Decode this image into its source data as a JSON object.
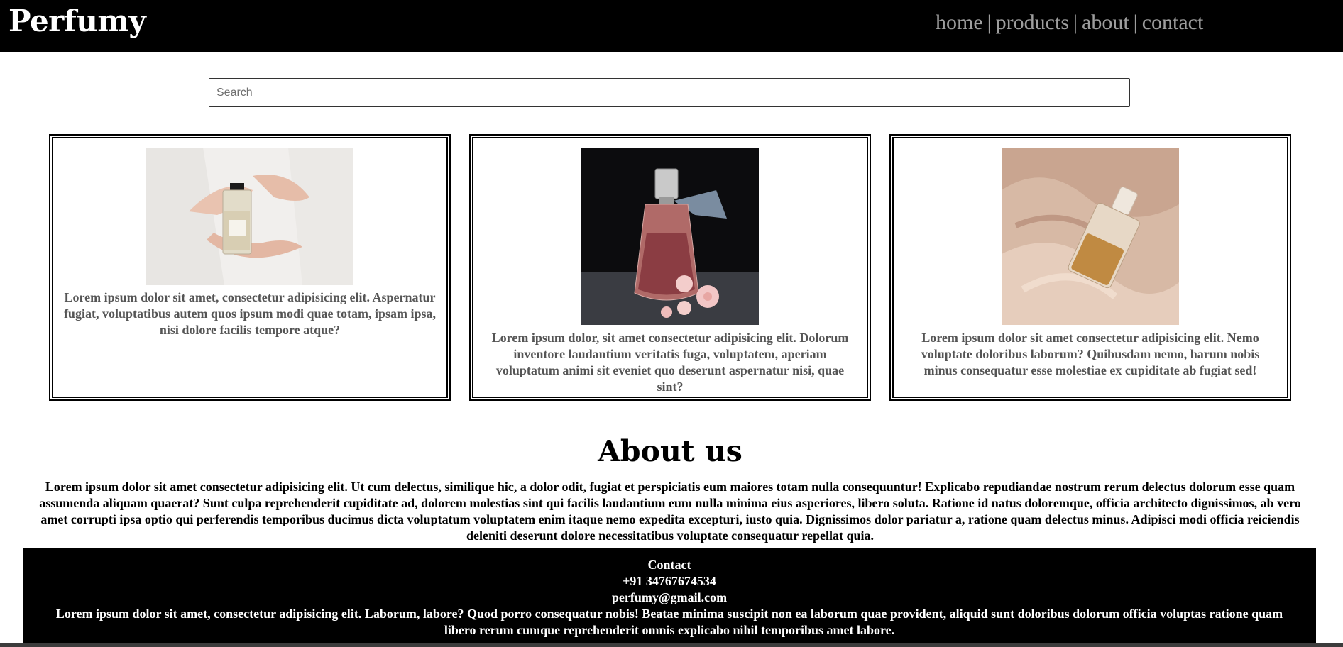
{
  "header": {
    "brand": "Perfumy",
    "nav": [
      {
        "label": "home"
      },
      {
        "label": "products"
      },
      {
        "label": "about"
      },
      {
        "label": "contact"
      }
    ],
    "separator": "|"
  },
  "search": {
    "placeholder": "Search",
    "value": ""
  },
  "products": [
    {
      "image_icon": "perfume-hands-photo",
      "text": "Lorem ipsum dolor sit amet, consectetur adipisicing elit. Aspernatur fugiat, voluptatibus autem quos ipsum modi quae totam, ipsam ipsa, nisi dolore facilis tempore atque?"
    },
    {
      "image_icon": "perfume-flowers-photo",
      "text": "Lorem ipsum dolor, sit amet consectetur adipisicing elit. Dolorum inventore laudantium veritatis fuga, voluptatem, aperiam voluptatum animi sit eveniet quo deserunt aspernatur nisi, quae sint?"
    },
    {
      "image_icon": "perfume-satin-photo",
      "text": "Lorem ipsum dolor sit amet consectetur adipisicing elit. Nemo voluptate doloribus laborum? Quibusdam nemo, harum nobis minus consequatur esse molestiae ex cupiditate ab fugiat sed!"
    }
  ],
  "about": {
    "title": "About us",
    "text": "Lorem ipsum dolor sit amet consectetur adipisicing elit. Ut cum delectus, similique hic, a dolor odit, fugiat et perspiciatis eum maiores totam nulla consequuntur! Explicabo repudiandae nostrum rerum delectus dolorum esse quam assumenda aliquam quaerat? Sunt culpa reprehenderit cupiditate ad, dolorem molestias sint qui facilis laudantium eum nulla minima eius asperiores, libero soluta. Ratione id natus doloremque, officia architecto dignissimos, ab vero amet corrupti ipsa optio qui perferendis temporibus ducimus dicta voluptatum voluptatem enim itaque nemo expedita excepturi, iusto quia. Dignissimos dolor pariatur a, ratione quam delectus minus. Adipisci modi officia reiciendis deleniti deserunt dolore necessitatibus voluptate consequatur repellat quia."
  },
  "footer": {
    "title": "Contact",
    "phone": "+91 34767674534",
    "email": "perfumy@gmail.com",
    "text": "Lorem ipsum dolor sit amet, consectetur adipisicing elit. Laborum, labore? Quod porro consequatur nobis! Beatae minima suscipit non ea laborum quae provident, aliquid sunt doloribus dolorum officia voluptas ratione quam libero rerum cumque reprehenderit omnis explicabo nihil temporibus amet labore."
  },
  "colors": {
    "header_bg": "#000000",
    "nav_text": "#9e9e9e",
    "card_text": "#555555",
    "footer_bg": "#000000"
  }
}
